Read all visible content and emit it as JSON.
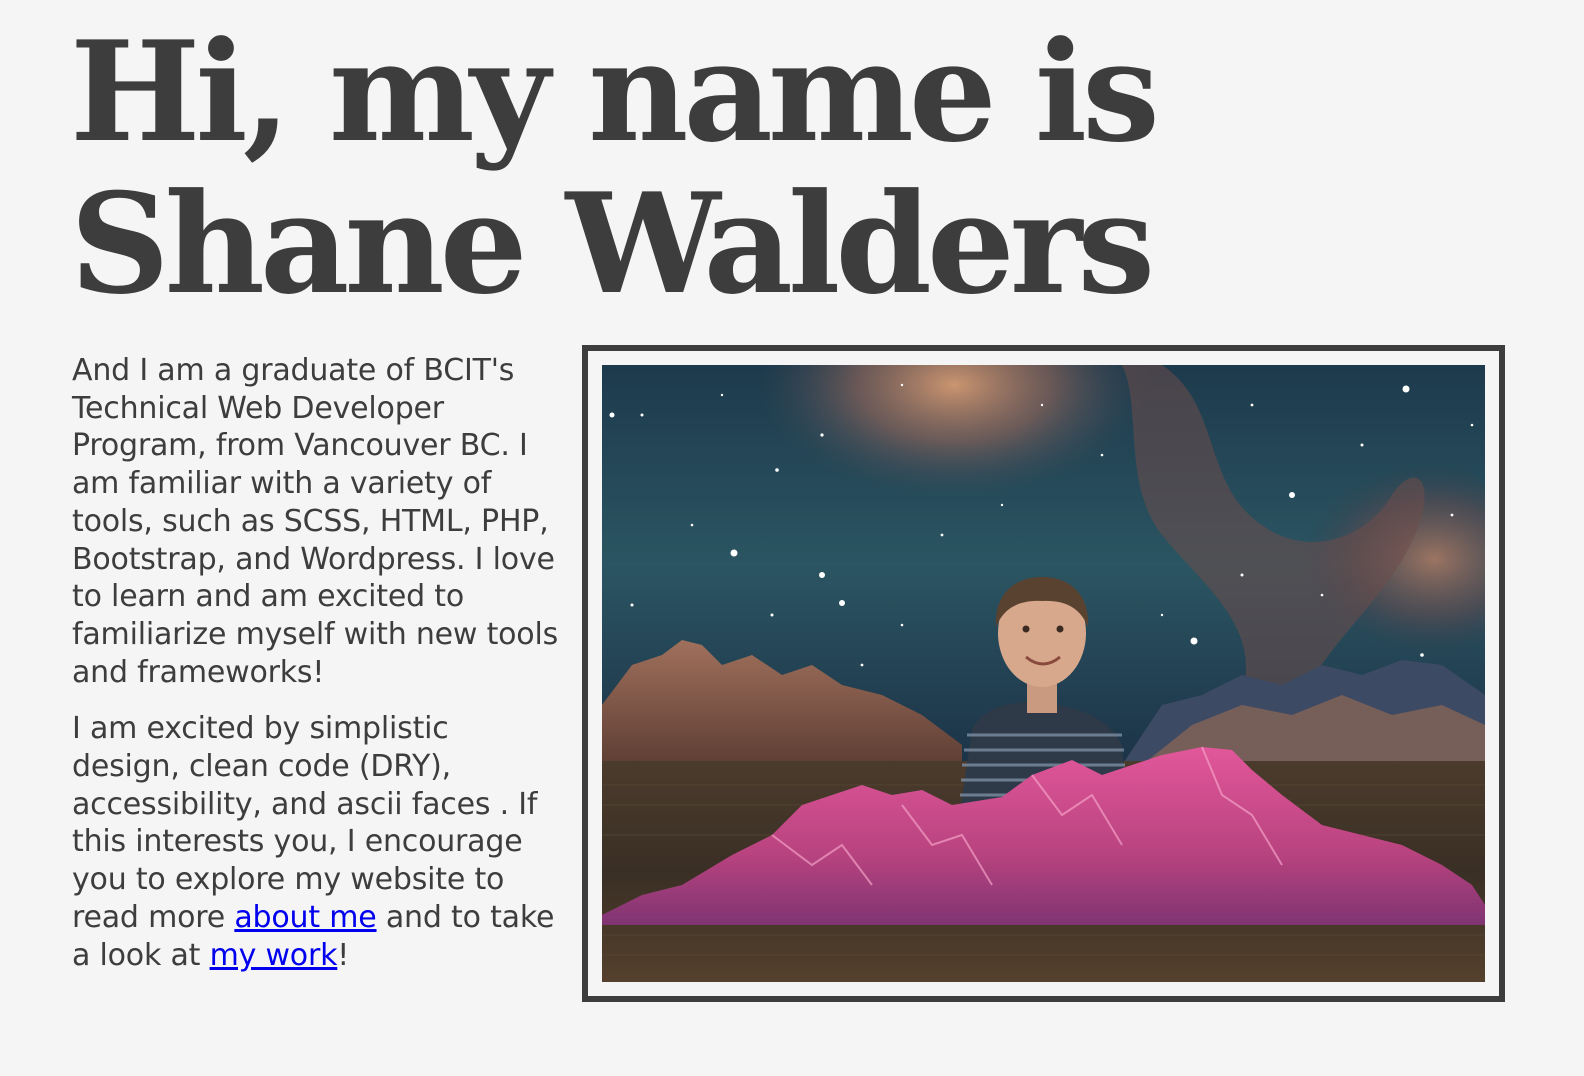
{
  "headline": {
    "line1": "Hi, my name is",
    "line2": "Shane Walders"
  },
  "intro": {
    "paragraph1": "And I am a graduate of BCIT's Technical Web Developer Program, from Vancouver BC. I am familiar with a variety of tools, such as SCSS, HTML, PHP, Bootstrap, and Wordpress. I love to learn and am excited to familiarize myself with new tools and frameworks!",
    "paragraph2_before": "I am excited by simplistic design, clean code (DRY), accessibility, and ascii faces . If this interests you, I encourage you to explore my website to read more ",
    "about_link": "about me",
    "paragraph2_middle": " and to take a look at ",
    "work_link": "my work",
    "paragraph2_end": "!"
  },
  "photo": {
    "subject": "collage-child-nebula-mountains"
  },
  "colors": {
    "text": "#3d3d3d",
    "background": "#f5f5f5",
    "link": "#0000ee",
    "frame": "#3d3d3d"
  }
}
